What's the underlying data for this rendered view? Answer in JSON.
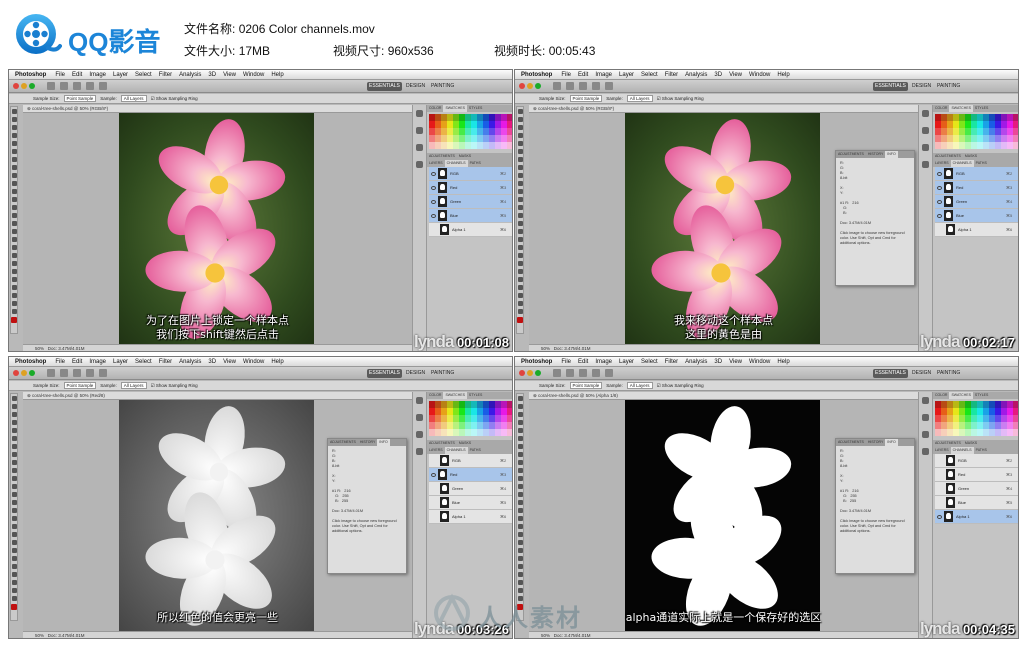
{
  "brand": {
    "logo_text": "QQ影音"
  },
  "file_info": {
    "name_label": "文件名称:",
    "name_value": "0206 Color channels.mov",
    "size_label": "文件大小:",
    "size_value": "17MB",
    "dim_label": "视频尺寸:",
    "dim_value": "960x536",
    "duration_label": "视频时长:",
    "duration_value": "00:05:43"
  },
  "ps": {
    "app_name": "Photoshop",
    "menus": [
      "File",
      "Edit",
      "Image",
      "Layer",
      "Select",
      "Filter",
      "Analysis",
      "3D",
      "View",
      "Window",
      "Help"
    ],
    "workspaces": [
      "ESSENTIALS",
      "DESIGN",
      "PAINTING"
    ],
    "options": {
      "sample_size_label": "Sample Size:",
      "sample_size_value": "Point Sample",
      "sample_label": "Sample:",
      "sample_value": "All Layers",
      "show_ring": "Show Sampling Ring"
    },
    "status_zoom": "50%",
    "status_doc": "Doc: 3.47M/4.01M"
  },
  "frames": [
    {
      "doc_tab": "coral-tree-shells.psd @ 50% (RGB/8*)",
      "channels": [
        "RGB",
        "Red",
        "Green",
        "Blue",
        "Alpha 1"
      ],
      "shortcuts": [
        "⌘2",
        "⌘3",
        "⌘4",
        "⌘5",
        "⌘6"
      ],
      "subtitle_line1": "为了在图片上锁定一个样本点",
      "subtitle_line2": "我们按下shift键然后点击",
      "timecode": "00:01:08",
      "watermark": "lynda"
    },
    {
      "doc_tab": "coral-tree-shells.psd @ 50% (RGB/8*)",
      "channels": [
        "RGB",
        "Red",
        "Green",
        "Blue",
        "Alpha 1"
      ],
      "shortcuts": [
        "⌘2",
        "⌘3",
        "⌘4",
        "⌘5",
        "⌘6"
      ],
      "subtitle_line1": "我来移动这个样本点",
      "subtitle_line2": "这里的黄色是由",
      "timecode": "00:02:17",
      "watermark": "lynda",
      "info_tabs": [
        "ADJUSTMENTS",
        "HISTORY",
        "INFO"
      ],
      "info_text": "R:\nG:\nB:\n8-bit\n\nX:\nY:\n\n#1 R:   216\n   G:\n   B:\n\nDoc: 3.47M/4.01M\n\nClick image to choose new foreground\ncolor. Use Shift, Opt and Cmd for\nadditional options."
    },
    {
      "doc_tab": "coral-tree-shells.psd @ 50% (Red/8)",
      "channels": [
        "RGB",
        "Red",
        "Green",
        "Blue",
        "Alpha 1"
      ],
      "shortcuts": [
        "⌘2",
        "⌘3",
        "⌘4",
        "⌘5",
        "⌘6"
      ],
      "subtitle_line1": "所以红色的值会更亮一些",
      "subtitle_line2": "",
      "timecode": "00:03:26",
      "watermark": "lynda",
      "info_tabs": [
        "ADJUSTMENTS",
        "HISTORY",
        "INFO"
      ],
      "info_text": "R:\nG:\nB:\n8-bit\n\nX:\nY:\n\n#1 R:   216\n   G:   255\n   B:   255\n\nDoc: 3.47M/4.01M\n\nClick image to choose new foreground\ncolor. Use Shift, Opt and Cmd for\nadditional options."
    },
    {
      "doc_tab": "coral-tree-shells.psd @ 50% (Alpha 1/8)",
      "channels": [
        "RGB",
        "Red",
        "Green",
        "Blue",
        "Alpha 1"
      ],
      "shortcuts": [
        "⌘2",
        "⌘3",
        "⌘4",
        "⌘5",
        "⌘6"
      ],
      "subtitle_line1": "alpha通道实际上就是一个保存好的选区",
      "subtitle_line2": "",
      "timecode": "00:04:35",
      "watermark": "lynda",
      "info_tabs": [
        "ADJUSTMENTS",
        "HISTORY",
        "INFO"
      ],
      "info_text": "R:\nG:\nB:\n8-bit\n\nX:\nY:\n\n#1 R:   216\n   G:   255\n   B:   255\n\nDoc: 3.47M/4.01M\n\nClick image to choose new foreground\ncolor. Use Shift, Opt and Cmd for\nadditional options."
    }
  ],
  "overlay_watermark": "人人素材",
  "colors": {
    "brand_blue": "#1c85d8",
    "selection_blue": "#a8c5ea",
    "flower_pink": "#e8609a",
    "flower_yellow": "#f6c43c"
  }
}
